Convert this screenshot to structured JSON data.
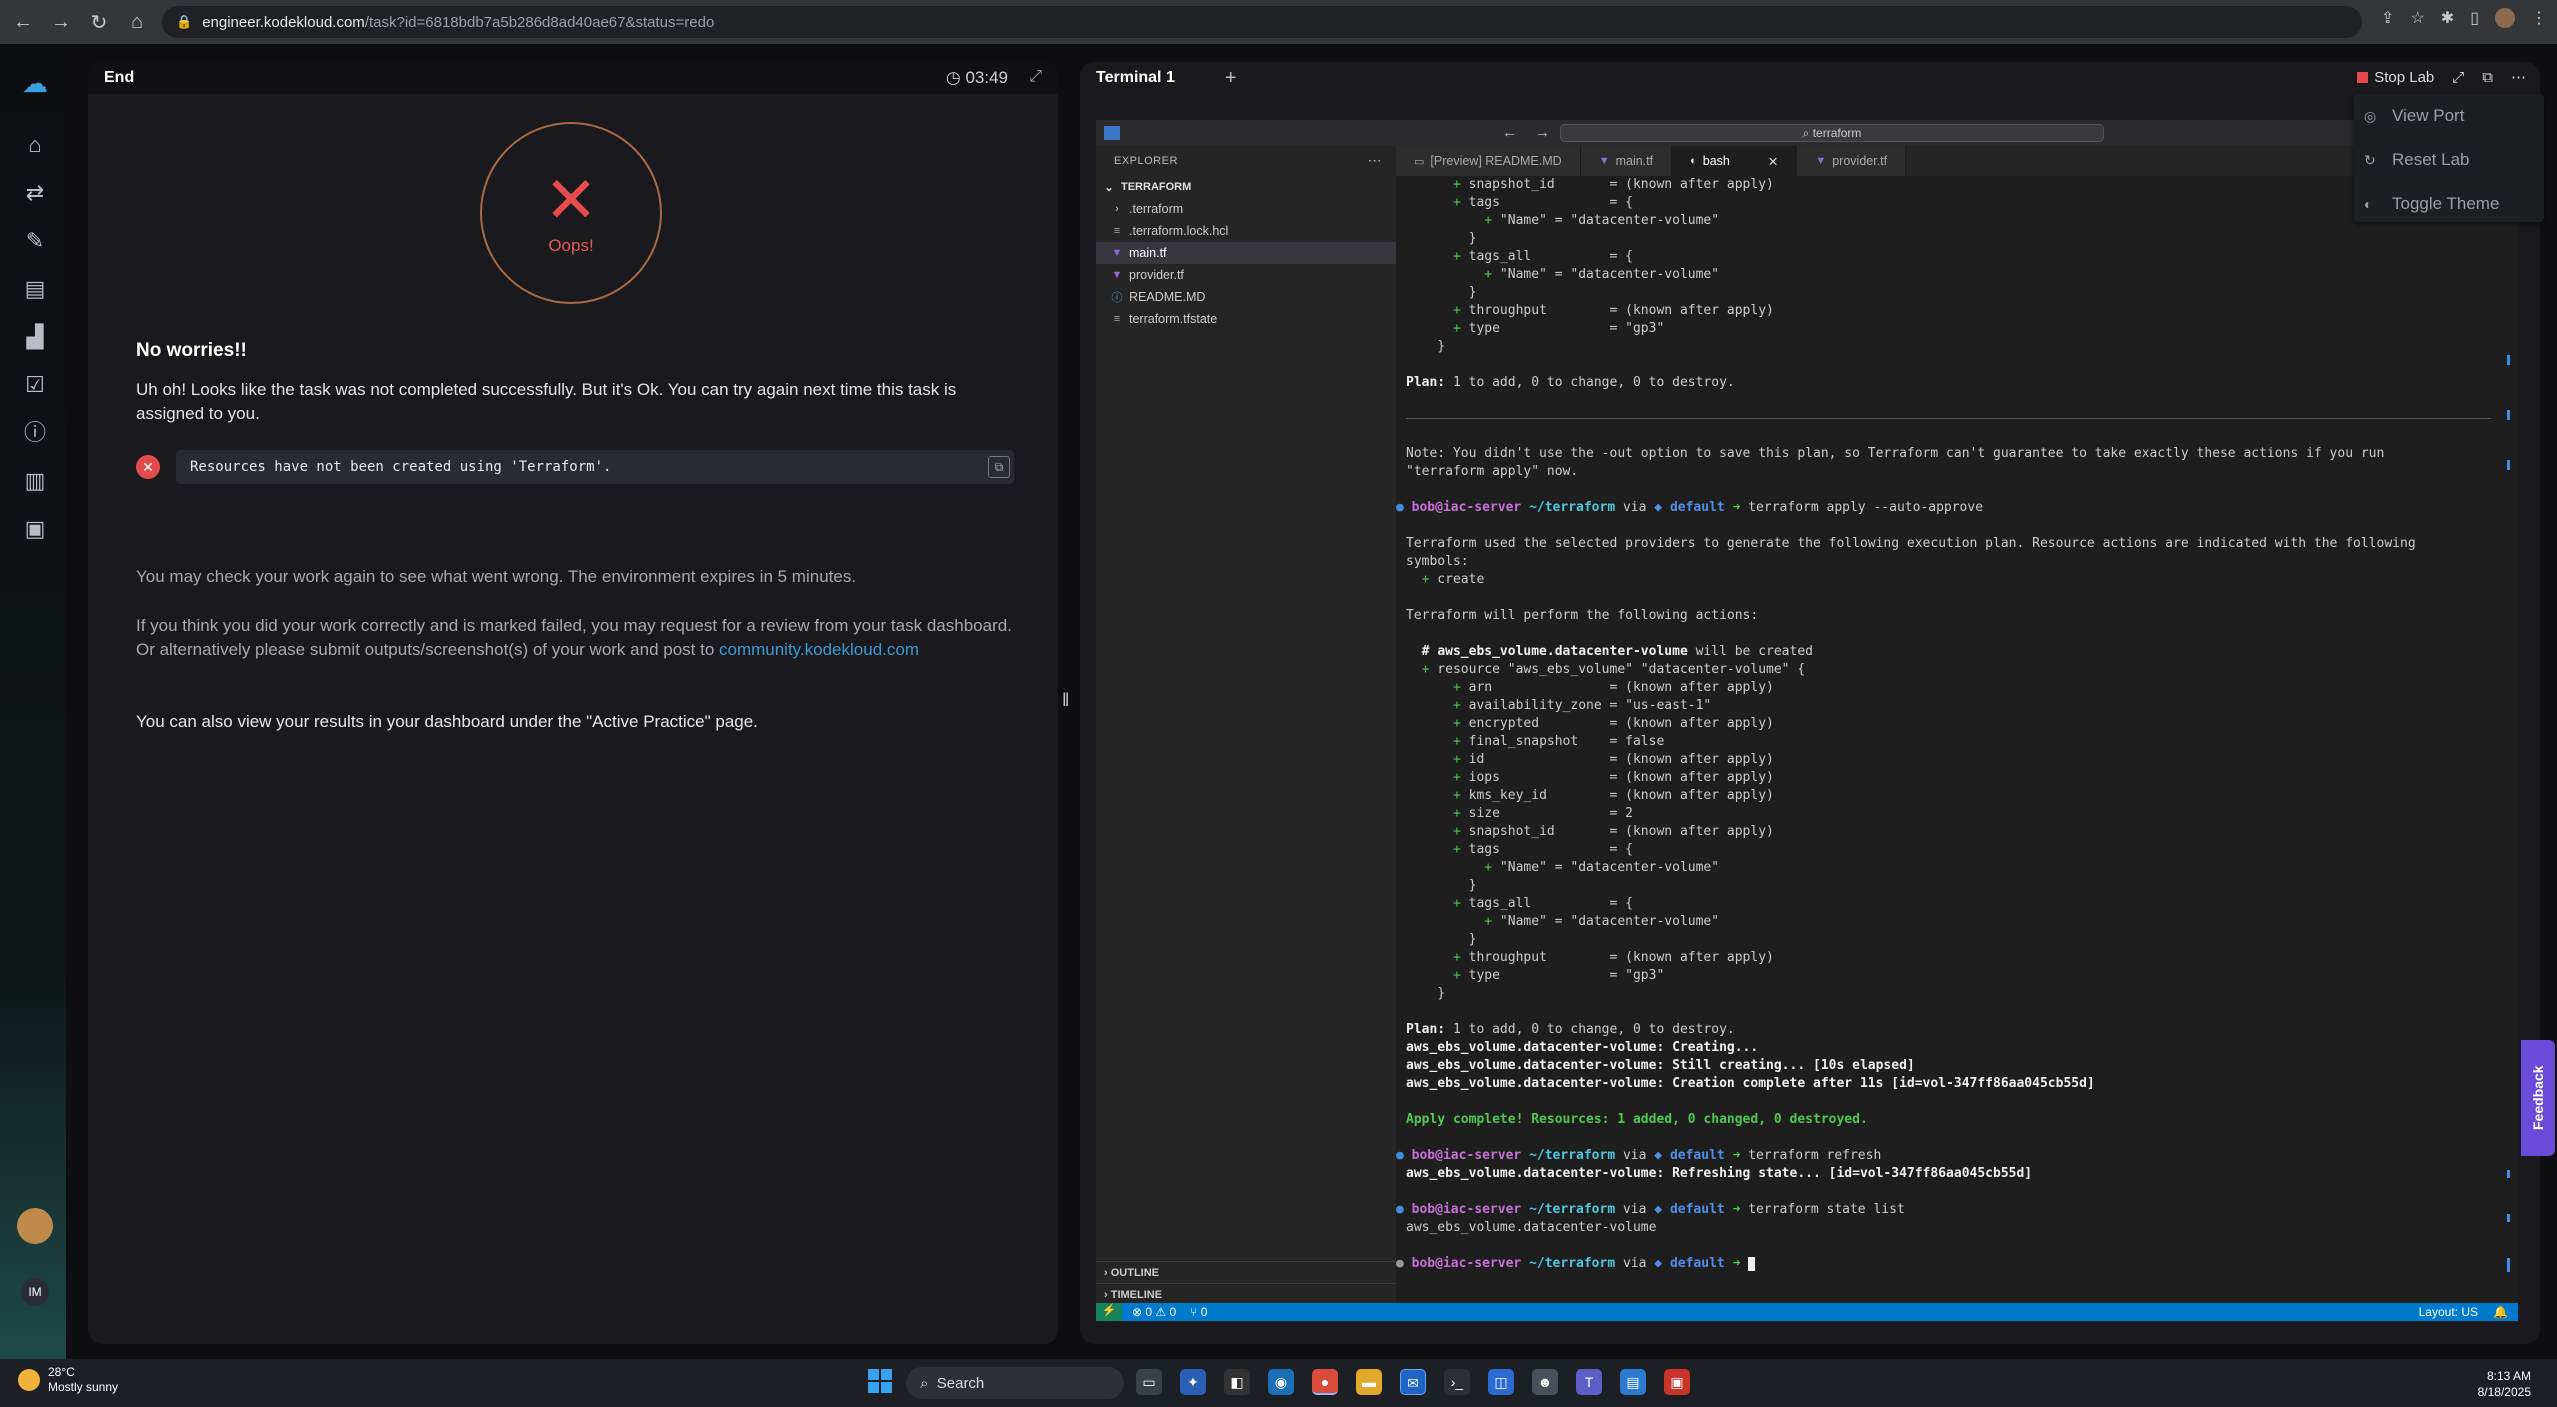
{
  "browser": {
    "url_host": "engineer.kodekloud.com",
    "url_path": "/task?id=6818bdb7a5b286d8ad40ae67&status=redo"
  },
  "left": {
    "header_title": "End",
    "timer": "03:49",
    "oops_label": "Oops!",
    "title": "No worries!!",
    "body": "Uh oh! Looks like the task was not completed successfully. But it's Ok. You can try again next time this task is assigned to you.",
    "error_message": "Resources have not been created using 'Terraform'.",
    "p_check": "You may check your work again to see what went wrong. The environment expires in 5 minutes.",
    "p_review_prefix": "If you think you did your work correctly and is marked failed, you may request for a review from your task dashboard. Or alternatively please submit outputs/screenshot(s) of your work and post to ",
    "p_review_link": "community.kodekloud.com",
    "p_dashboard": "You can also view your results in your dashboard under the \"Active Practice\" page."
  },
  "right": {
    "tab_label": "Terminal 1",
    "add_tab": "+",
    "stop_lab": "Stop Lab"
  },
  "menu": {
    "items": [
      "View Port",
      "Reset Lab",
      "Toggle Theme"
    ]
  },
  "vscode": {
    "search": "terraform",
    "explorer_header": "EXPLORER",
    "folder": "TERRAFORM",
    "files": [
      ".terraform",
      ".terraform.lock.hcl",
      "main.tf",
      "provider.tf",
      "README.MD",
      "terraform.tfstate"
    ],
    "outline": "OUTLINE",
    "timeline": "TIMELINE",
    "tabs": [
      "[Preview] README.MD",
      "main.tf",
      "bash",
      "provider.tf"
    ],
    "status": {
      "problems": "⊗ 0 ⚠ 0",
      "ports": "⑂ 0",
      "layout": "Layout: US"
    }
  },
  "terminal_lines": [
    {
      "t": "      + snapshot_id       = (known after apply)"
    },
    {
      "t": "      + tags              = {"
    },
    {
      "t": "          + \"Name\" = \"datacenter-volume\""
    },
    {
      "t": "        }"
    },
    {
      "t": "      + tags_all          = {"
    },
    {
      "t": "          + \"Name\" = \"datacenter-volume\""
    },
    {
      "t": "        }"
    },
    {
      "t": "      + throughput        = (known after apply)"
    },
    {
      "t": "      + type              = \"gp3\""
    },
    {
      "t": "    }"
    },
    {
      "t": ""
    },
    {
      "t": "Plan: 1 to add, 0 to change, 0 to destroy.",
      "k": "plan"
    },
    {
      "t": ""
    },
    {
      "t": "",
      "k": "sep"
    },
    {
      "t": ""
    },
    {
      "t": "Note: You didn't use the -out option to save this plan, so Terraform can't guarantee to take exactly these actions if you run"
    },
    {
      "t": "\"terraform apply\" now."
    },
    {
      "t": ""
    },
    {
      "t": "terraform apply --auto-approve",
      "k": "prompt"
    },
    {
      "t": ""
    },
    {
      "t": "Terraform used the selected providers to generate the following execution plan. Resource actions are indicated with the following"
    },
    {
      "t": "symbols:"
    },
    {
      "t": "  + create"
    },
    {
      "t": ""
    },
    {
      "t": "Terraform will perform the following actions:"
    },
    {
      "t": ""
    },
    {
      "t": "  # aws_ebs_volume.datacenter-volume will be created",
      "k": "comment"
    },
    {
      "t": "  + resource \"aws_ebs_volume\" \"datacenter-volume\" {"
    },
    {
      "t": "      + arn               = (known after apply)"
    },
    {
      "t": "      + availability_zone = \"us-east-1\""
    },
    {
      "t": "      + encrypted         = (known after apply)"
    },
    {
      "t": "      + final_snapshot    = false"
    },
    {
      "t": "      + id                = (known after apply)"
    },
    {
      "t": "      + iops              = (known after apply)"
    },
    {
      "t": "      + kms_key_id        = (known after apply)"
    },
    {
      "t": "      + size              = 2"
    },
    {
      "t": "      + snapshot_id       = (known after apply)"
    },
    {
      "t": "      + tags              = {"
    },
    {
      "t": "          + \"Name\" = \"datacenter-volume\""
    },
    {
      "t": "        }"
    },
    {
      "t": "      + tags_all          = {"
    },
    {
      "t": "          + \"Name\" = \"datacenter-volume\""
    },
    {
      "t": "        }"
    },
    {
      "t": "      + throughput        = (known after apply)"
    },
    {
      "t": "      + type              = \"gp3\""
    },
    {
      "t": "    }"
    },
    {
      "t": ""
    },
    {
      "t": "Plan: 1 to add, 0 to change, 0 to destroy.",
      "k": "plan"
    },
    {
      "t": "aws_ebs_volume.datacenter-volume: Creating...",
      "k": "bold"
    },
    {
      "t": "aws_ebs_volume.datacenter-volume: Still creating... [10s elapsed]",
      "k": "bold"
    },
    {
      "t": "aws_ebs_volume.datacenter-volume: Creation complete after 11s [id=vol-347ff86aa045cb55d]",
      "k": "bold"
    },
    {
      "t": ""
    },
    {
      "t": "Apply complete! Resources: 1 added, 0 changed, 0 destroyed.",
      "k": "ok"
    },
    {
      "t": ""
    },
    {
      "t": "terraform refresh",
      "k": "prompt"
    },
    {
      "t": "aws_ebs_volume.datacenter-volume: Refreshing state... [id=vol-347ff86aa045cb55d]",
      "k": "bold"
    },
    {
      "t": ""
    },
    {
      "t": "terraform state list",
      "k": "prompt"
    },
    {
      "t": "aws_ebs_volume.datacenter-volume"
    },
    {
      "t": ""
    },
    {
      "t": "",
      "k": "prompt_last"
    }
  ],
  "prompt": {
    "user": "bob@iac-server",
    "path": "~/terraform",
    "via": "via",
    "env": "◆ default",
    "arrow": "➜"
  },
  "feedback": "Feedback",
  "taskbar": {
    "temp": "28°C",
    "weather": "Mostly sunny",
    "search": "Search",
    "time": "8:13 AM",
    "date": "8/18/2025"
  }
}
